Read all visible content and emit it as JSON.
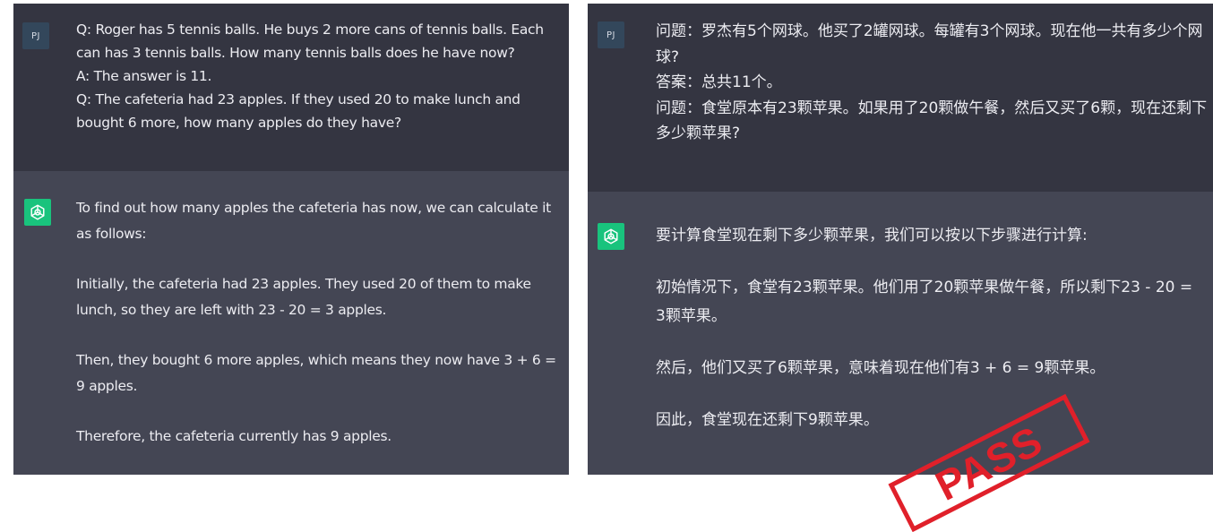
{
  "left": {
    "user_avatar": "PJ",
    "user_lines": [
      "Q: Roger has 5 tennis balls. He buys 2 more cans of tennis balls. Each can has 3 tennis balls. How many tennis balls does he have now?",
      "A: The answer is 11.",
      "Q: The cafeteria had 23 apples. If they used 20 to make lunch and bought 6 more, how many apples do they have?"
    ],
    "bot_icon": "openai-logo-icon",
    "bot_paragraphs": [
      "To find out how many apples the cafeteria has now, we can calculate it as follows:",
      "Initially, the cafeteria had 23 apples. They used 20 of them to make lunch, so they are left with 23 - 20 = 3 apples.",
      "Then, they bought 6 more apples, which means they now have 3 + 6 = 9 apples.",
      "Therefore, the cafeteria currently has 9 apples."
    ]
  },
  "right": {
    "user_avatar": "PJ",
    "user_lines": [
      "问题：罗杰有5个网球。他买了2罐网球。每罐有3个网球。现在他一共有多少个网球?",
      "答案：总共11个。",
      "问题：食堂原本有23颗苹果。如果用了20颗做午餐，然后又买了6颗，现在还剩下多少颗苹果?"
    ],
    "bot_icon": "openai-logo-icon",
    "bot_paragraphs": [
      "要计算食堂现在剩下多少颗苹果，我们可以按以下步骤进行计算:",
      "初始情况下，食堂有23颗苹果。他们用了20颗苹果做午餐，所以剩下23 - 20 = 3颗苹果。",
      "然后，他们又买了6颗苹果，意味着现在他们有3 + 6 = 9颗苹果。",
      "因此，食堂现在还剩下9颗苹果。"
    ]
  },
  "stamp": {
    "text": "PASS",
    "color": "#e0202a"
  },
  "colors": {
    "user_bg": "#343541",
    "bot_bg": "#444654",
    "bot_avatar": "#19c37d",
    "user_avatar": "#33475b",
    "text": "#ececf1"
  }
}
